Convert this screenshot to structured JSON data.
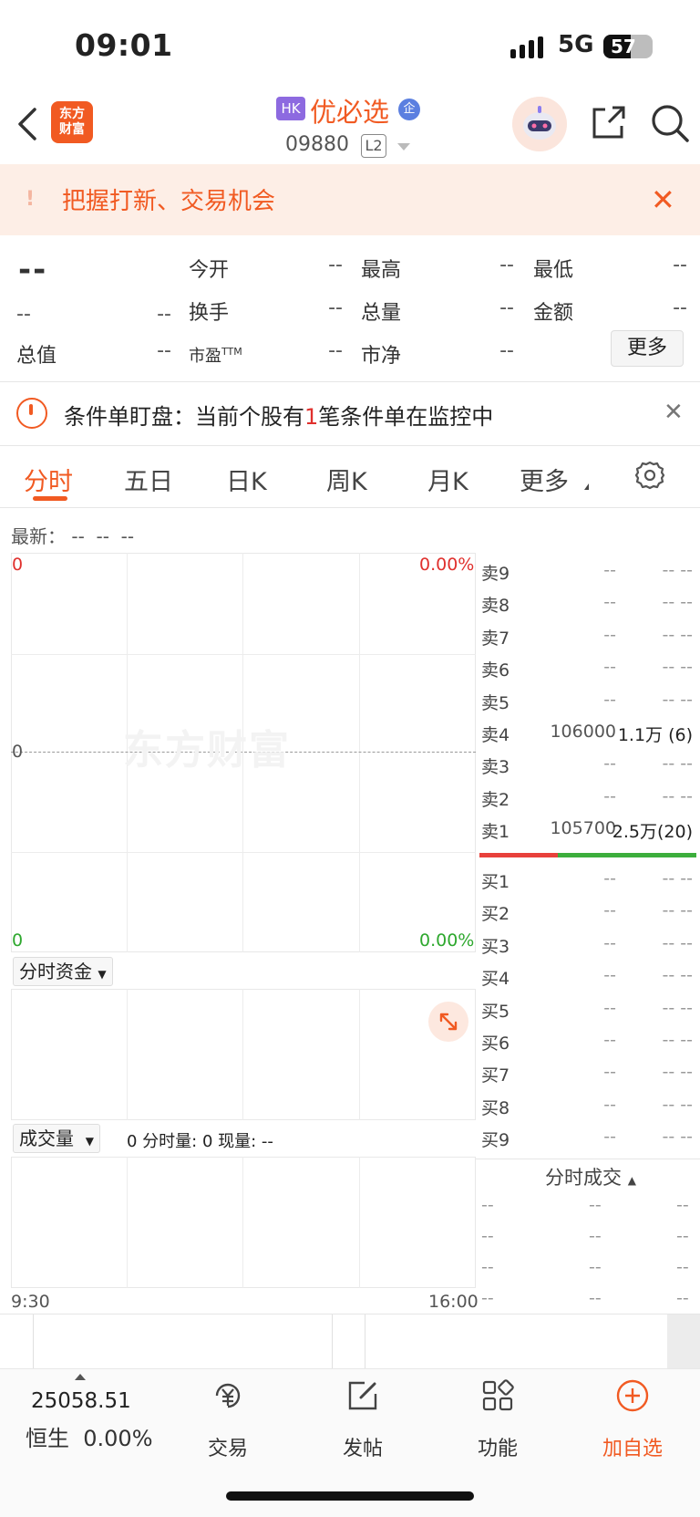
{
  "status_bar": {
    "time": "09:01",
    "network": "5G",
    "battery": "57"
  },
  "header": {
    "logo_text": "东方财富",
    "market_badge": "HK",
    "stock_name": "优必选",
    "badge_qi": "企",
    "stock_code": "09880",
    "level_badge": "L2"
  },
  "banner": {
    "text": "把握打新、交易机会",
    "icon": "!"
  },
  "quote": {
    "price": "--",
    "change": "--",
    "change_pct": "--",
    "rows": [
      [
        {
          "label": "今开",
          "value": "--"
        },
        {
          "label": "最高",
          "value": "--"
        },
        {
          "label": "最低",
          "value": "--"
        }
      ],
      [
        {
          "label": "换手",
          "value": "--"
        },
        {
          "label": "总量",
          "value": "--"
        },
        {
          "label": "金额",
          "value": "--"
        }
      ],
      [
        {
          "label": "市盈",
          "sup": "TTM",
          "value": "--"
        },
        {
          "label": "市净",
          "value": "--"
        }
      ]
    ],
    "total_value_label": "总值",
    "total_value": "--",
    "more_label": "更多"
  },
  "condition": {
    "prefix": "条件单盯盘：当前个股有",
    "count": "1",
    "suffix": "笔条件单在监控中"
  },
  "tabs": [
    "分时",
    "五日",
    "日K",
    "周K",
    "月K",
    "更多"
  ],
  "chart": {
    "latest_label": "最新：",
    "latest_values": [
      "--",
      "--",
      "--"
    ],
    "top_left": "0",
    "top_right": "0.00%",
    "mid_left": "0",
    "bottom_left": "0",
    "bottom_right": "0.00%",
    "watermark": "东方财富",
    "fund_dropdown": "分时资金",
    "volume_dropdown": "成交量",
    "volume_info": "0 分时量: 0 现量: --",
    "time_start": "9:30",
    "time_end": "16:00"
  },
  "order_book": {
    "asks": [
      {
        "label": "卖9",
        "price": "--",
        "vol": "--  --"
      },
      {
        "label": "卖8",
        "price": "--",
        "vol": "--  --"
      },
      {
        "label": "卖7",
        "price": "--",
        "vol": "--  --"
      },
      {
        "label": "卖6",
        "price": "--",
        "vol": "--  --"
      },
      {
        "label": "卖5",
        "price": "--",
        "vol": "--  --"
      },
      {
        "label": "卖4",
        "price": "106000",
        "vol": "1.1万 (6)"
      },
      {
        "label": "卖3",
        "price": "--",
        "vol": "--  --"
      },
      {
        "label": "卖2",
        "price": "--",
        "vol": "--  --"
      },
      {
        "label": "卖1",
        "price": "105700",
        "vol": "2.5万(20)"
      }
    ],
    "bids": [
      {
        "label": "买1",
        "price": "--",
        "vol": "--  --"
      },
      {
        "label": "买2",
        "price": "--",
        "vol": "--  --"
      },
      {
        "label": "买3",
        "price": "--",
        "vol": "--  --"
      },
      {
        "label": "买4",
        "price": "--",
        "vol": "--  --"
      },
      {
        "label": "买5",
        "price": "--",
        "vol": "--  --"
      },
      {
        "label": "买6",
        "price": "--",
        "vol": "--  --"
      },
      {
        "label": "买7",
        "price": "--",
        "vol": "--  --"
      },
      {
        "label": "买8",
        "price": "--",
        "vol": "--  --"
      },
      {
        "label": "买9",
        "price": "--",
        "vol": "--  --"
      }
    ],
    "trades_title": "分时成交",
    "trades": [
      [
        "--",
        "--",
        "--"
      ],
      [
        "--",
        "--",
        "--"
      ],
      [
        "--",
        "--",
        "--"
      ],
      [
        "--",
        "--",
        "--"
      ]
    ]
  },
  "bottom_bar": {
    "index_value": "25058.51",
    "index_name": "恒生",
    "index_pct": "0.00%",
    "items": [
      "交易",
      "发帖",
      "功能",
      "加自选"
    ]
  },
  "colors": {
    "accent": "#f15a22",
    "up": "#e0302d",
    "down": "#2ea82e"
  }
}
